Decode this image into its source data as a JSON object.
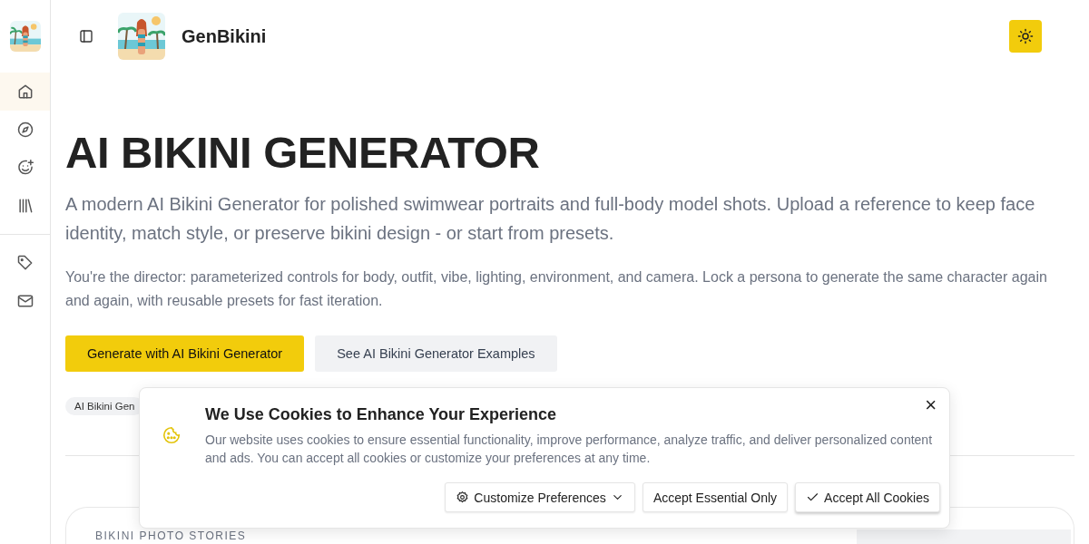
{
  "sidebar": {
    "items": [
      {
        "kind": "home",
        "selected": true
      },
      {
        "kind": "compass",
        "selected": false
      },
      {
        "kind": "smile",
        "selected": false
      },
      {
        "kind": "library",
        "selected": false
      }
    ],
    "secondary_items": [
      {
        "kind": "tag",
        "selected": false
      },
      {
        "kind": "mail",
        "selected": false
      }
    ]
  },
  "header": {
    "brand": "GenBikini"
  },
  "hero": {
    "title": "AI BIKINI GENERATOR",
    "subtitle": "A modern AI Bikini Generator for polished swimwear portraits and full-body model shots. Upload a reference to keep face identity, match style, or preserve bikini design - or start from presets.",
    "description": "You're the director: parameterized controls for body, outfit, vibe, lighting, environment, and camera. Lock a persona to generate the same character again and again, with reusable presets for fast iteration.",
    "buttons": [
      {
        "label": "Generate with AI Bikini Generator",
        "kind": "primary"
      },
      {
        "label": "See AI Bikini Generator Examples",
        "kind": "secondary"
      }
    ],
    "chips": [
      "AI Bikini Gen"
    ]
  },
  "section": {
    "label": "BIKINI PHOTO STORIES"
  },
  "cookie_banner": {
    "title": "We Use Cookies to Enhance Your Experience",
    "text": "Our website uses cookies to ensure essential functionality, improve performance, analyze traffic, and deliver personalized content and ads. You can accept all cookies or customize your preferences at any time.",
    "close": "×",
    "buttons": [
      {
        "label": "Customize Preferences",
        "kind": "customize"
      },
      {
        "label": "Accept Essential Only",
        "kind": "essential"
      },
      {
        "label": "Accept All Cookies",
        "kind": "accept"
      }
    ]
  }
}
